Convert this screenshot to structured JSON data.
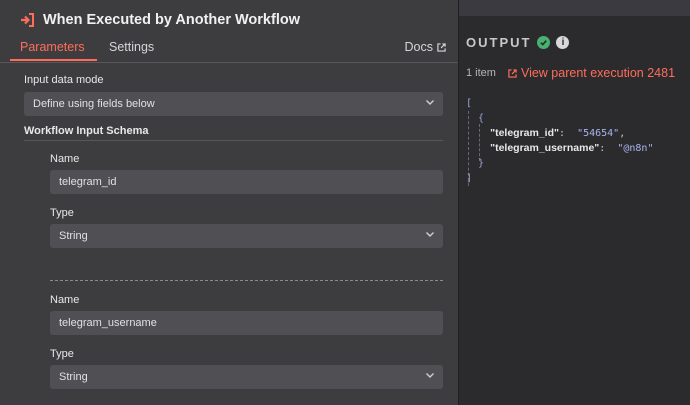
{
  "node": {
    "title": "When Executed by Another Workflow"
  },
  "tabs": [
    {
      "label": "Parameters"
    },
    {
      "label": "Settings"
    }
  ],
  "docs_label": "Docs",
  "input_data_mode": {
    "label": "Input data mode",
    "value": "Define using fields below"
  },
  "schema_label": "Workflow Input Schema",
  "fields": [
    {
      "name_label": "Name",
      "name_value": "telegram_id",
      "type_label": "Type",
      "type_value": "String"
    },
    {
      "name_label": "Name",
      "name_value": "telegram_username",
      "type_label": "Type",
      "type_value": "String"
    }
  ],
  "output": {
    "title": "OUTPUT",
    "item_count": "1 item",
    "parent_link": "View parent execution 2481",
    "json": {
      "open_bracket": "[",
      "open_brace": "{",
      "key1": "\"telegram_id\"",
      "val1": "\"54654\"",
      "key2": "\"telegram_username\"",
      "val2": "\"@n8n\"",
      "close_brace": "}",
      "close_bracket": "]"
    }
  },
  "colors": {
    "accent": "#ff6d5a",
    "success": "#4ab071",
    "panel": "#3d3d40",
    "field": "#505054"
  }
}
